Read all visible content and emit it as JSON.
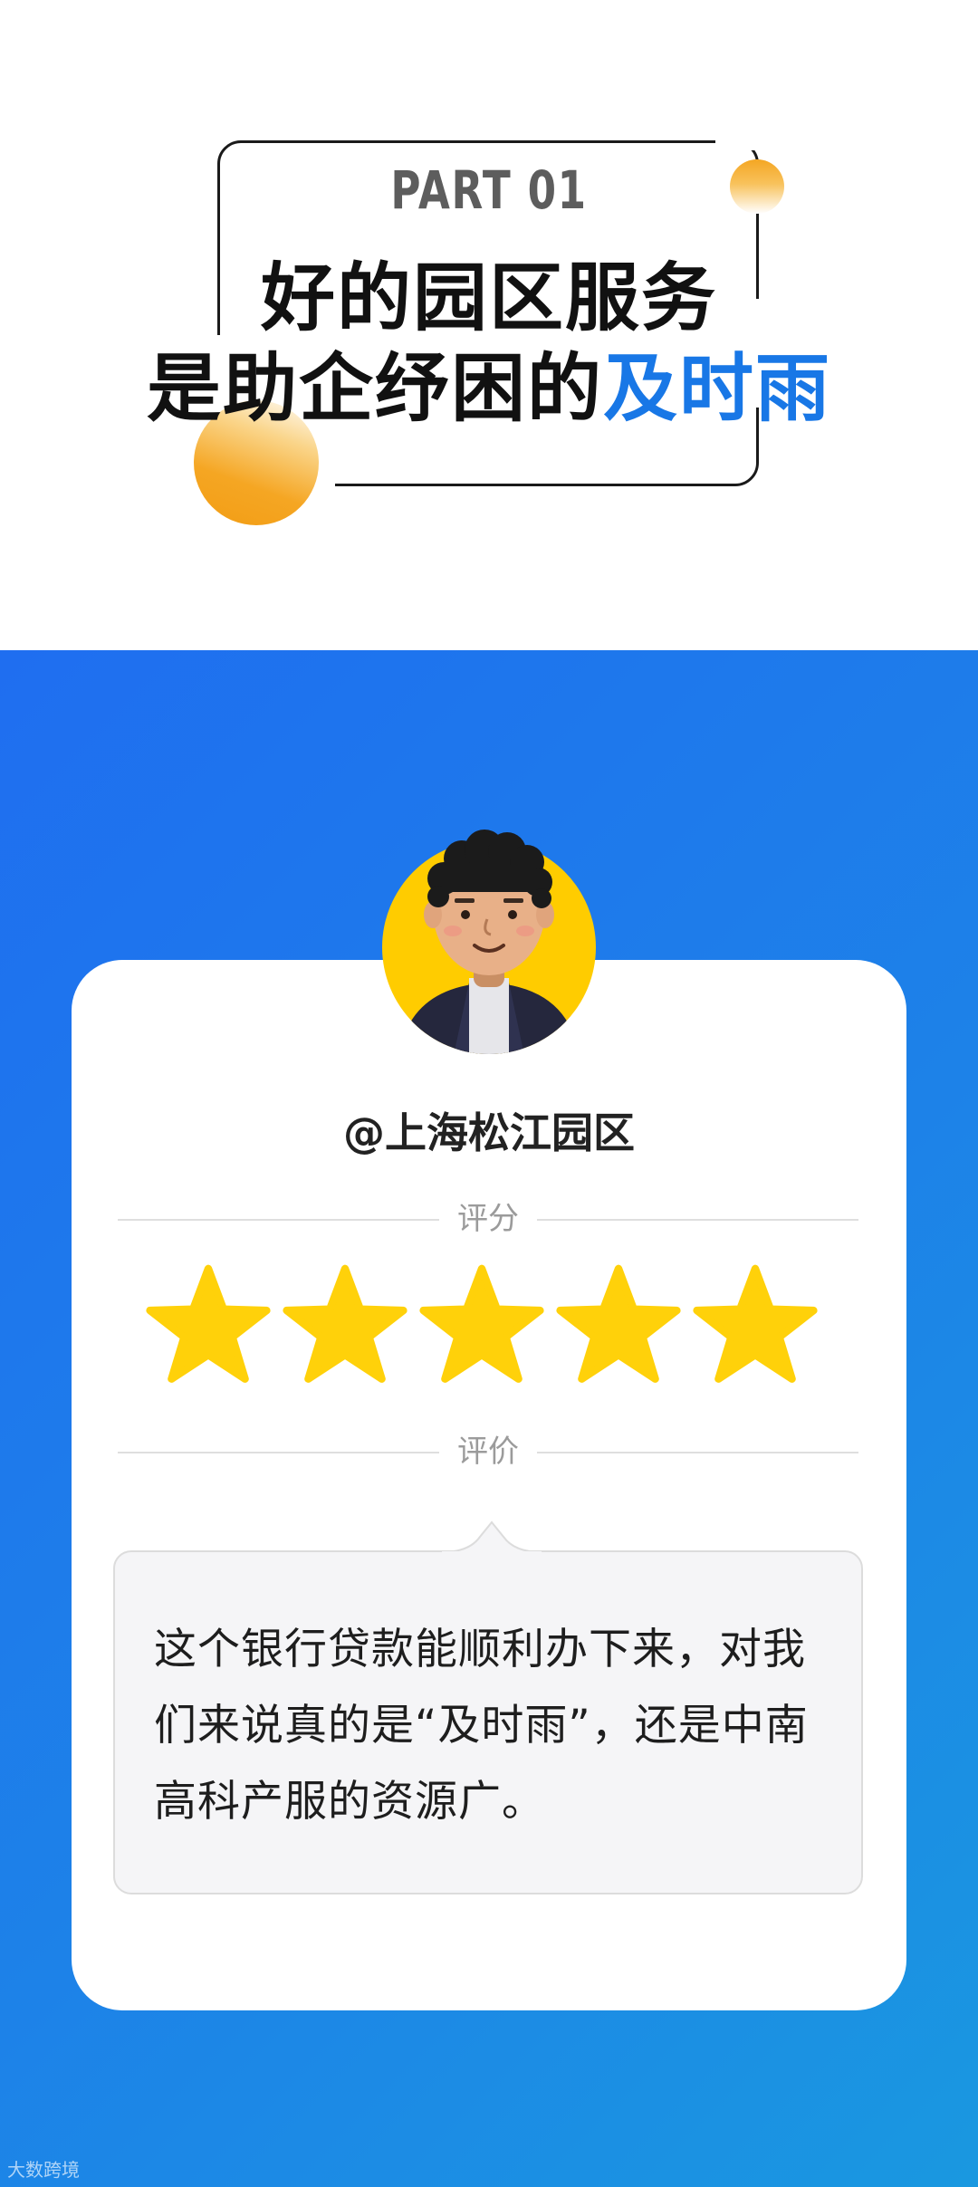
{
  "header": {
    "part_label": "PART 01",
    "title_line1": "好的园区服务",
    "title_line2_prefix": "是助企纾困的",
    "title_line2_accent": "及时雨"
  },
  "profile": {
    "username": "@上海松江园区"
  },
  "rating": {
    "label": "评分",
    "stars": 5,
    "max_stars": 5
  },
  "review": {
    "label": "评价",
    "text": "这个银行贷款能顺利办下来，对我们来说真的是“及时雨”，还是中南高科产服的资源广。"
  },
  "watermark": {
    "text": "大数跨境"
  },
  "colors": {
    "accent_blue": "#1877e6",
    "background_blue_start": "#1f6ef0",
    "background_blue_end": "#1a98e0",
    "star_yellow": "#ffd10a",
    "ball_orange": "#f5a623"
  }
}
